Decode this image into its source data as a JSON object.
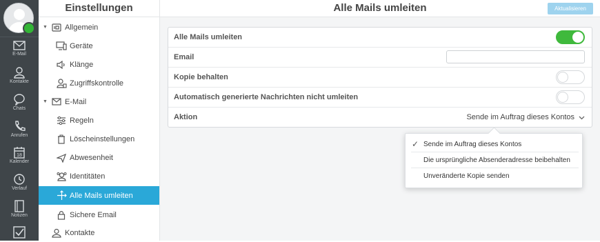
{
  "app": {
    "rail": [
      {
        "label": "E-Mail",
        "icon": "mail-icon"
      },
      {
        "label": "Kontakte",
        "icon": "contacts-icon"
      },
      {
        "label": "Chats",
        "icon": "chat-icon"
      },
      {
        "label": "Anrufen",
        "icon": "phone-icon"
      },
      {
        "label": "Kalender",
        "icon": "calendar-icon",
        "day": "18"
      },
      {
        "label": "Verlauf",
        "icon": "history-icon"
      },
      {
        "label": "Notizen",
        "icon": "notes-icon"
      },
      {
        "label": "",
        "icon": "tasks-icon"
      }
    ],
    "status_color": "#33b536"
  },
  "sidebar": {
    "title": "Einstellungen",
    "items": [
      {
        "label": "Allgemein",
        "icon": "general-icon"
      },
      {
        "label": "Geräte",
        "icon": "devices-icon"
      },
      {
        "label": "Klänge",
        "icon": "sound-icon"
      },
      {
        "label": "Zugriffskontrolle",
        "icon": "access-control-icon"
      },
      {
        "label": "E-Mail",
        "icon": "mail-icon"
      },
      {
        "label": "Regeln",
        "icon": "rules-icon"
      },
      {
        "label": "Löscheinstellungen",
        "icon": "trash-icon"
      },
      {
        "label": "Abwesenheit",
        "icon": "plane-icon"
      },
      {
        "label": "Identitäten",
        "icon": "identities-icon"
      },
      {
        "label": "Alle Mails umleiten",
        "icon": "redirect-icon",
        "active": true
      },
      {
        "label": "Sichere Email",
        "icon": "lock-icon"
      },
      {
        "label": "Kontakte",
        "icon": "contacts-icon"
      }
    ]
  },
  "main": {
    "title": "Alle Mails umleiten",
    "update_button": "Aktualisieren",
    "rows": {
      "redirect_all": {
        "label": "Alle Mails umleiten",
        "enabled": true
      },
      "email": {
        "label": "Email",
        "value": ""
      },
      "keep_copy": {
        "label": "Kopie behalten",
        "enabled": false
      },
      "no_auto": {
        "label": "Automatisch generierte Nachrichten nicht umleiten",
        "enabled": false
      },
      "action": {
        "label": "Aktion",
        "value": "Sende im Auftrag dieses Kontos"
      }
    },
    "dropdown": {
      "options": [
        "Sende im Auftrag dieses Kontos",
        "Die ursprüngliche Absenderadresse beibehalten",
        "Unveränderte Kopie senden"
      ],
      "selected_index": 0
    }
  },
  "colors": {
    "accent": "#2aa8d8",
    "toggle_on": "#3fb93c",
    "rail_bg": "#3f4549"
  }
}
